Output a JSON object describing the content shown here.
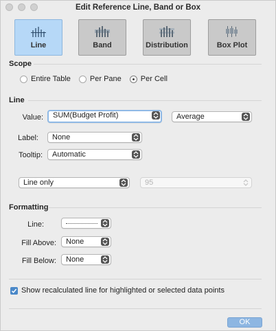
{
  "window": {
    "title": "Edit Reference Line, Band or Box"
  },
  "types": [
    {
      "label": "Line",
      "selected": true,
      "icon": "line-chart-icon"
    },
    {
      "label": "Band",
      "selected": false,
      "icon": "band-chart-icon"
    },
    {
      "label": "Distribution",
      "selected": false,
      "icon": "distribution-chart-icon"
    },
    {
      "label": "Box Plot",
      "selected": false,
      "icon": "box-plot-icon"
    }
  ],
  "scope": {
    "title": "Scope",
    "options": [
      {
        "label": "Entire Table",
        "selected": false
      },
      {
        "label": "Per Pane",
        "selected": false
      },
      {
        "label": "Per Cell",
        "selected": true
      }
    ]
  },
  "line": {
    "title": "Line",
    "value_label": "Value:",
    "value": "SUM(Budget Profit)",
    "aggregation": "Average",
    "label_label": "Label:",
    "label_value": "None",
    "tooltip_label": "Tooltip:",
    "tooltip_value": "Automatic",
    "ci_mode": "Line only",
    "ci_percent": "95"
  },
  "formatting": {
    "title": "Formatting",
    "line_label": "Line:",
    "fill_above_label": "Fill Above:",
    "fill_above_value": "None",
    "fill_below_label": "Fill Below:",
    "fill_below_value": "None"
  },
  "recalc": {
    "label": "Show recalculated line for highlighted or selected data points",
    "checked": true
  },
  "ok_label": "OK",
  "colors": {
    "accent": "#4a88c8",
    "selected_tile": "#b6d8f7",
    "ok_button": "#8db6e2"
  }
}
